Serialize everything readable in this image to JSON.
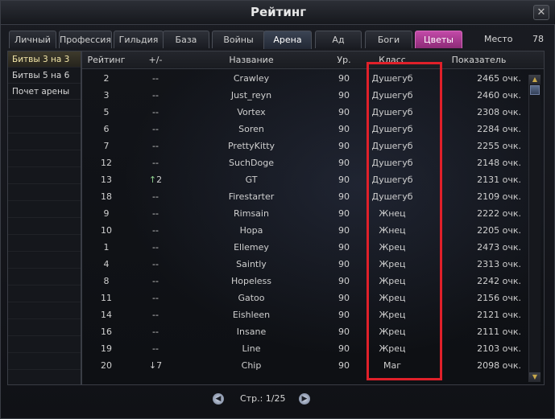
{
  "window": {
    "title": "Рейтинг"
  },
  "tabs": [
    {
      "label": "Личный"
    },
    {
      "label": "Профессия"
    },
    {
      "label": "Гильдия"
    },
    {
      "label": "База"
    },
    {
      "label": "Войны"
    },
    {
      "label": "Арена"
    },
    {
      "label": "Ад"
    },
    {
      "label": "Боги"
    },
    {
      "label": "Цветы"
    }
  ],
  "active_tab": "Арена",
  "place": {
    "label": "Место",
    "value": "78"
  },
  "sidebar": {
    "items": [
      {
        "label": "Битвы 3 на 3",
        "active": true
      },
      {
        "label": "Битвы 5 на 6",
        "active": false
      },
      {
        "label": "Почет арены",
        "active": false
      }
    ]
  },
  "table": {
    "headers": {
      "rank": "Рейтинг",
      "diff": "+/-",
      "name": "Название",
      "level": "Ур.",
      "class": "Класс",
      "score": "Показатель"
    },
    "rows": [
      {
        "rank": "2",
        "diff": "--",
        "arrow": "",
        "name": "Crawley",
        "level": "90",
        "class": "Душегуб",
        "score": "2465 очк."
      },
      {
        "rank": "3",
        "diff": "--",
        "arrow": "",
        "name": "Just_reyn",
        "level": "90",
        "class": "Душегуб",
        "score": "2460 очк."
      },
      {
        "rank": "5",
        "diff": "--",
        "arrow": "",
        "name": "Vortex",
        "level": "90",
        "class": "Душегуб",
        "score": "2308 очк."
      },
      {
        "rank": "6",
        "diff": "--",
        "arrow": "",
        "name": "Soren",
        "level": "90",
        "class": "Душегуб",
        "score": "2284 очк."
      },
      {
        "rank": "7",
        "diff": "--",
        "arrow": "",
        "name": "PrettyKitty",
        "level": "90",
        "class": "Душегуб",
        "score": "2255 очк."
      },
      {
        "rank": "12",
        "diff": "--",
        "arrow": "",
        "name": "SuchDoge",
        "level": "90",
        "class": "Душегуб",
        "score": "2148 очк."
      },
      {
        "rank": "13",
        "diff": "2",
        "arrow": "↑",
        "name": "GT",
        "level": "90",
        "class": "Душегуб",
        "score": "2131 очк."
      },
      {
        "rank": "18",
        "diff": "--",
        "arrow": "",
        "name": "Firestarter",
        "level": "90",
        "class": "Душегуб",
        "score": "2109 очк."
      },
      {
        "rank": "9",
        "diff": "--",
        "arrow": "",
        "name": "Rimsain",
        "level": "90",
        "class": "Жнец",
        "score": "2222 очк."
      },
      {
        "rank": "10",
        "diff": "--",
        "arrow": "",
        "name": "Hopa",
        "level": "90",
        "class": "Жнец",
        "score": "2205 очк."
      },
      {
        "rank": "1",
        "diff": "--",
        "arrow": "",
        "name": "Ellemey",
        "level": "90",
        "class": "Жрец",
        "score": "2473 очк."
      },
      {
        "rank": "4",
        "diff": "--",
        "arrow": "",
        "name": "Saintly",
        "level": "90",
        "class": "Жрец",
        "score": "2313 очк."
      },
      {
        "rank": "8",
        "diff": "--",
        "arrow": "",
        "name": "Hopeless",
        "level": "90",
        "class": "Жрец",
        "score": "2242 очк."
      },
      {
        "rank": "11",
        "diff": "--",
        "arrow": "",
        "name": "Gatoo",
        "level": "90",
        "class": "Жрец",
        "score": "2156 очк."
      },
      {
        "rank": "14",
        "diff": "--",
        "arrow": "",
        "name": "Eishleen",
        "level": "90",
        "class": "Жрец",
        "score": "2121 очк."
      },
      {
        "rank": "16",
        "diff": "--",
        "arrow": "",
        "name": "Insane",
        "level": "90",
        "class": "Жрец",
        "score": "2111 очк."
      },
      {
        "rank": "19",
        "diff": "--",
        "arrow": "",
        "name": "Line",
        "level": "90",
        "class": "Жрец",
        "score": "2103 очк."
      },
      {
        "rank": "20",
        "diff": "7",
        "arrow": "↓",
        "name": "Chip",
        "level": "90",
        "class": "Маг",
        "score": "2098 очк."
      }
    ]
  },
  "pager": {
    "text": "Стр.: 1/25"
  },
  "icons": {
    "close": "close-icon",
    "prev": "arrow-left-icon",
    "next": "arrow-right-icon",
    "scroll_up": "triangle-up-icon",
    "scroll_down": "triangle-down-icon"
  },
  "colors": {
    "highlight_box": "#e0202a",
    "active_tab_pink": "#c24aa8",
    "arrow_up": "#8ed08e"
  }
}
